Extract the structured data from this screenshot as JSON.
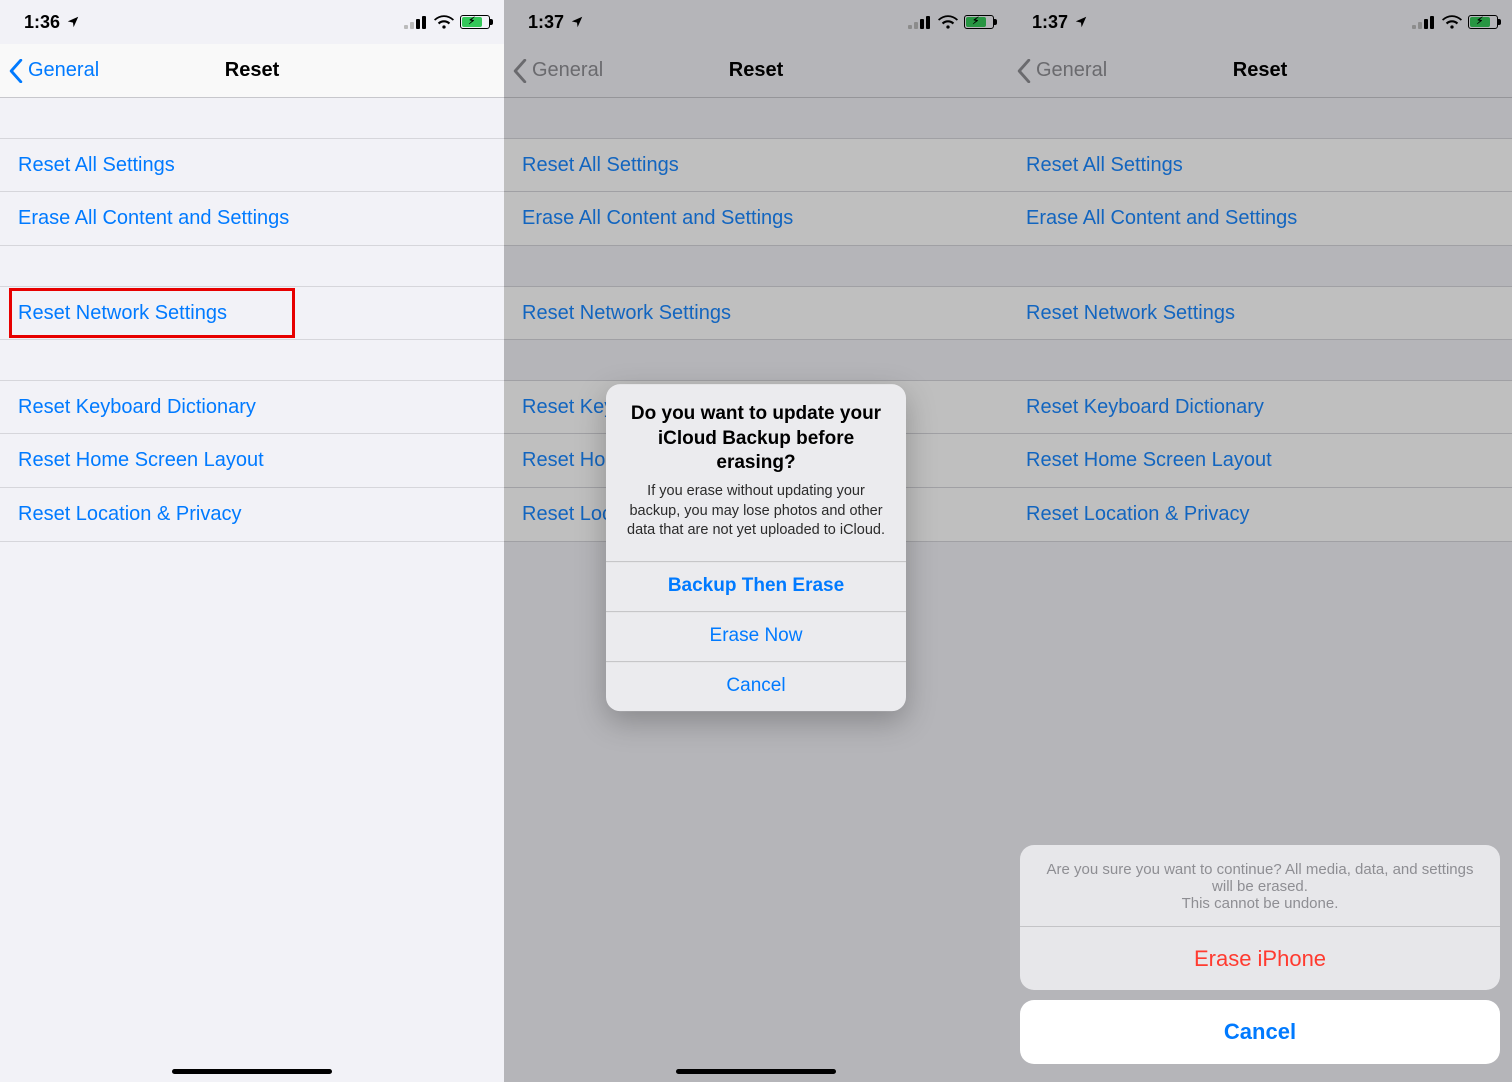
{
  "status": {
    "times": [
      "1:36",
      "1:37",
      "1:37"
    ]
  },
  "nav": {
    "back": "General",
    "title": "Reset"
  },
  "rows": {
    "reset_all": "Reset All Settings",
    "erase_all": "Erase All Content and Settings",
    "reset_network": "Reset Network Settings",
    "reset_keyboard": "Reset Keyboard Dictionary",
    "reset_home": "Reset Home Screen Layout",
    "reset_location": "Reset Location & Privacy"
  },
  "alert_center": {
    "title": "Do you want to update your iCloud Backup before erasing?",
    "message": "If you erase without updating your backup, you may lose photos and other data that are not yet uploaded to iCloud.",
    "backup": "Backup Then Erase",
    "erase_now": "Erase Now",
    "cancel": "Cancel"
  },
  "sheet": {
    "message": "Are you sure you want to continue? All media, data, and settings will be erased.\nThis cannot be undone.",
    "erase": "Erase iPhone",
    "cancel": "Cancel"
  }
}
